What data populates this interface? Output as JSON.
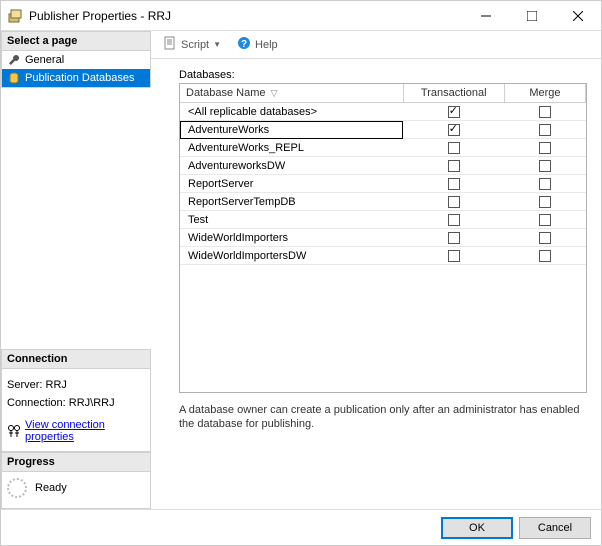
{
  "window": {
    "title": "Publisher Properties - RRJ"
  },
  "left": {
    "select_header": "Select a page",
    "nav": [
      {
        "label": "General",
        "icon": "wrench-icon",
        "selected": false
      },
      {
        "label": "Publication Databases",
        "icon": "database-icon",
        "selected": true
      }
    ],
    "connection_header": "Connection",
    "server_label": "Server: RRJ",
    "connection_label": "Connection: RRJ\\RRJ",
    "view_connection_link": "View connection properties",
    "progress_header": "Progress",
    "progress_status": "Ready"
  },
  "toolbar": {
    "script_label": "Script",
    "help_label": "Help"
  },
  "content": {
    "databases_label": "Databases:",
    "columns": {
      "name": "Database Name",
      "transactional": "Transactional",
      "merge": "Merge"
    },
    "rows": [
      {
        "name": "<All replicable databases>",
        "transactional": true,
        "merge": false,
        "selected": false
      },
      {
        "name": "AdventureWorks",
        "transactional": true,
        "merge": false,
        "selected": true
      },
      {
        "name": "AdventureWorks_REPL",
        "transactional": false,
        "merge": false,
        "selected": false
      },
      {
        "name": "AdventureworksDW",
        "transactional": false,
        "merge": false,
        "selected": false
      },
      {
        "name": "ReportServer",
        "transactional": false,
        "merge": false,
        "selected": false
      },
      {
        "name": "ReportServerTempDB",
        "transactional": false,
        "merge": false,
        "selected": false
      },
      {
        "name": "Test",
        "transactional": false,
        "merge": false,
        "selected": false
      },
      {
        "name": "WideWorldImporters",
        "transactional": false,
        "merge": false,
        "selected": false
      },
      {
        "name": "WideWorldImportersDW",
        "transactional": false,
        "merge": false,
        "selected": false
      }
    ],
    "hint": "A database owner can create a publication only after an administrator has enabled the database for publishing."
  },
  "footer": {
    "ok": "OK",
    "cancel": "Cancel"
  }
}
